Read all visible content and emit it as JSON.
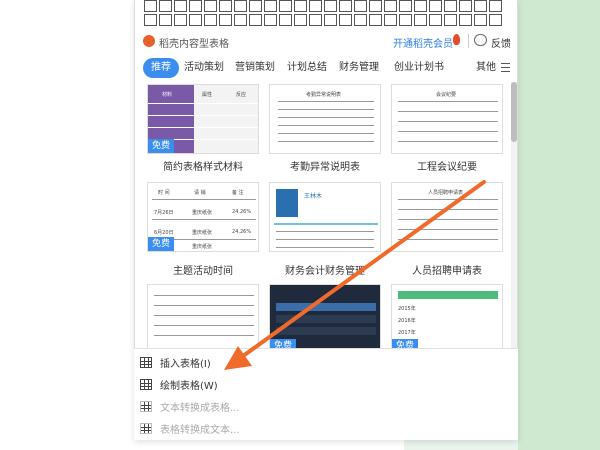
{
  "header": {
    "shell_label": "稻壳内容型表格",
    "vip_label": "开通稻壳会员",
    "feedback_label": "反馈"
  },
  "tabs": [
    {
      "label": "推荐",
      "active": true
    },
    {
      "label": "活动策划"
    },
    {
      "label": "营销策划"
    },
    {
      "label": "计划总结"
    },
    {
      "label": "财务管理"
    },
    {
      "label": "创业计划书"
    },
    {
      "label": "其他"
    }
  ],
  "templates": [
    {
      "title": "简约表格样式材料",
      "free": true,
      "badge": "免费"
    },
    {
      "title": "考勤异常说明表",
      "free": false
    },
    {
      "title": "工程会议纪要",
      "free": false
    },
    {
      "title": "主题活动时间",
      "free": true,
      "badge": "免费"
    },
    {
      "title": "财务会计财务管理",
      "free": false
    },
    {
      "title": "人员招聘申请表",
      "free": false
    },
    {
      "title": "",
      "free": false
    },
    {
      "title": "",
      "free": true,
      "badge": "免费"
    },
    {
      "title": "",
      "free": true,
      "badge": "免费"
    }
  ],
  "thumbs": {
    "c1_headers": [
      "材料",
      "属性",
      "反应"
    ],
    "c2_title": "考勤异常说明表",
    "c3_title": "会议纪要",
    "c4_headers": [
      "时 间",
      "请 销",
      "备 注"
    ],
    "c4_rows": [
      [
        "7月26日",
        "重庆纸张",
        "24.26%"
      ],
      [
        "6月20日",
        "重庆纸张",
        "24.26%"
      ],
      [
        "5月7日",
        "重庆纸张",
        "24.26%"
      ]
    ],
    "c5_name": "王林木",
    "c6_title": "人员招聘申请表",
    "c9_years": [
      "2015年",
      "2016年",
      "2017年"
    ]
  },
  "menu": {
    "insert_table": "插入表格(I)",
    "draw_table": "绘制表格(W)",
    "text_to_table": "文本转换成表格...",
    "table_to_text": "表格转换成文本..."
  },
  "colors": {
    "accent": "#3b8ef0",
    "arrow": "#f06a2c",
    "side_bg": "#cfe9d1"
  }
}
